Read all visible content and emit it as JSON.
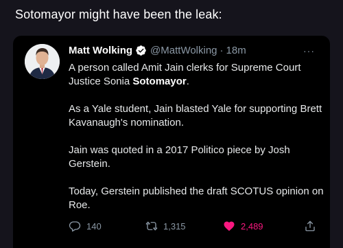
{
  "caption": "Sotomayor might have been the leak:",
  "tweet": {
    "author_name": "Matt Wolking",
    "handle": "@MattWolking",
    "separator": "·",
    "time": "18m",
    "more": "···",
    "body": {
      "p1_before": "A person called Amit Jain clerks for Supreme Court Justice Sonia ",
      "p1_bold": "Sotomayor",
      "p1_after": ".",
      "p2": "As a Yale student, Jain blasted Yale for supporting Brett Kavanaugh's nomination.",
      "p3": "Jain was quoted in a 2017 Politico piece by Josh Gerstein.",
      "p4": "Today, Gerstein published the draft SCOTUS opinion on Roe."
    },
    "actions": {
      "replies": "140",
      "retweets": "1,315",
      "likes": "2,489"
    },
    "icons": {
      "verified": "verified-badge-icon",
      "reply": "reply-bubble-icon",
      "retweet": "retweet-arrows-icon",
      "like": "heart-icon",
      "share": "share-icon"
    },
    "colors": {
      "like_active": "#f91880",
      "muted": "#8b98a5",
      "verified": "#1d9bf0"
    }
  }
}
